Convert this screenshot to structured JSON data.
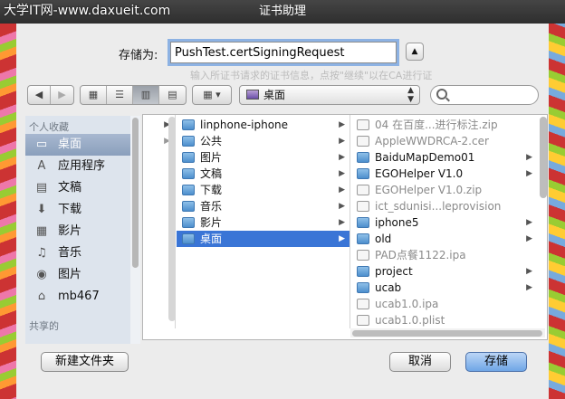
{
  "watermark": "大学IT网-www.daxueit.com",
  "window_title": "证书助理",
  "save_as": {
    "label": "存储为:",
    "value": "PushTest.certSigningRequest"
  },
  "ghost_text": "输入所证书请求的证书信息，点按\"继续\"以在CA进行证",
  "toolbar": {
    "back": "◀",
    "forward": "▶",
    "location": "桌面",
    "search_placeholder": ""
  },
  "sidebar": {
    "favorites_header": "个人收藏",
    "shared_header": "共享的",
    "items": [
      {
        "label": "桌面",
        "icon": "desktop-icon",
        "glyph": "▭"
      },
      {
        "label": "应用程序",
        "icon": "applications-icon",
        "glyph": "A"
      },
      {
        "label": "文稿",
        "icon": "documents-icon",
        "glyph": "▤"
      },
      {
        "label": "下载",
        "icon": "downloads-icon",
        "glyph": "⬇"
      },
      {
        "label": "影片",
        "icon": "movies-icon",
        "glyph": "▦"
      },
      {
        "label": "音乐",
        "icon": "music-icon",
        "glyph": "♫"
      },
      {
        "label": "图片",
        "icon": "pictures-icon",
        "glyph": "◉"
      },
      {
        "label": "mb467",
        "icon": "home-icon",
        "glyph": "⌂"
      }
    ]
  },
  "column2": [
    {
      "label": "linphone-iphone",
      "kind": "folder",
      "arrow": true
    },
    {
      "label": "公共",
      "kind": "folder",
      "arrow": true
    },
    {
      "label": "图片",
      "kind": "folder",
      "arrow": true
    },
    {
      "label": "文稿",
      "kind": "folder",
      "arrow": true
    },
    {
      "label": "下载",
      "kind": "folder",
      "arrow": true
    },
    {
      "label": "音乐",
      "kind": "folder",
      "arrow": true
    },
    {
      "label": "影片",
      "kind": "folder",
      "arrow": true
    },
    {
      "label": "桌面",
      "kind": "folder",
      "arrow": true,
      "selected": true
    }
  ],
  "column3": [
    {
      "label": "04 在百度...进行标注.zip",
      "kind": "file",
      "dim": true
    },
    {
      "label": "AppleWWDRCA-2.cer",
      "kind": "file",
      "dim": true
    },
    {
      "label": "BaiduMapDemo01",
      "kind": "folder",
      "arrow": true
    },
    {
      "label": "EGOHelper V1.0",
      "kind": "folder",
      "arrow": true
    },
    {
      "label": "EGOHelper V1.0.zip",
      "kind": "file",
      "dim": true
    },
    {
      "label": "ict_sdunisi...leprovision",
      "kind": "file",
      "dim": true
    },
    {
      "label": "iphone5",
      "kind": "folder",
      "arrow": true
    },
    {
      "label": "old",
      "kind": "folder",
      "arrow": true
    },
    {
      "label": "PAD点餐1122.ipa",
      "kind": "file",
      "dim": true
    },
    {
      "label": "project",
      "kind": "folder",
      "arrow": true
    },
    {
      "label": "ucab",
      "kind": "folder",
      "arrow": true
    },
    {
      "label": "ucab1.0.ipa",
      "kind": "file",
      "dim": true
    },
    {
      "label": "ucab1.0.plist",
      "kind": "file",
      "dim": true
    }
  ],
  "buttons": {
    "new_folder": "新建文件夹",
    "cancel": "取消",
    "save": "存储"
  }
}
